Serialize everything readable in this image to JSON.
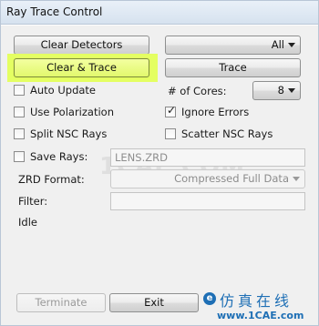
{
  "window": {
    "title": "Ray Trace Control"
  },
  "buttons": {
    "clear_detectors": "Clear Detectors",
    "clear_and_trace": "Clear & Trace",
    "trace": "Trace",
    "terminate": "Terminate",
    "exit": "Exit"
  },
  "detector_select": {
    "value": "All"
  },
  "options": {
    "auto_update": {
      "label": "Auto Update",
      "checked": false
    },
    "use_polarization": {
      "label": "Use Polarization",
      "checked": false
    },
    "ignore_errors": {
      "label": "Ignore Errors",
      "checked": true
    },
    "split_nsc_rays": {
      "label": "Split NSC Rays",
      "checked": false
    },
    "scatter_nsc_rays": {
      "label": "Scatter NSC Rays",
      "checked": false
    },
    "save_rays": {
      "label": "Save Rays:",
      "checked": false
    }
  },
  "cores": {
    "label": "# of Cores:",
    "value": "8"
  },
  "save_rays_file": {
    "value": "LENS.ZRD"
  },
  "zrd_format": {
    "label": "ZRD Format:",
    "value": "Compressed Full Data"
  },
  "filter": {
    "label": "Filter:",
    "value": ""
  },
  "status": {
    "text": "Idle"
  },
  "watermark": {
    "text": "1CAE.COM"
  },
  "brand": {
    "badge": "e",
    "title": "仿真在线",
    "url": "www.1CAE.com"
  },
  "colors": {
    "highlight": "#e4ff62",
    "brand": "#1e6fb5"
  }
}
